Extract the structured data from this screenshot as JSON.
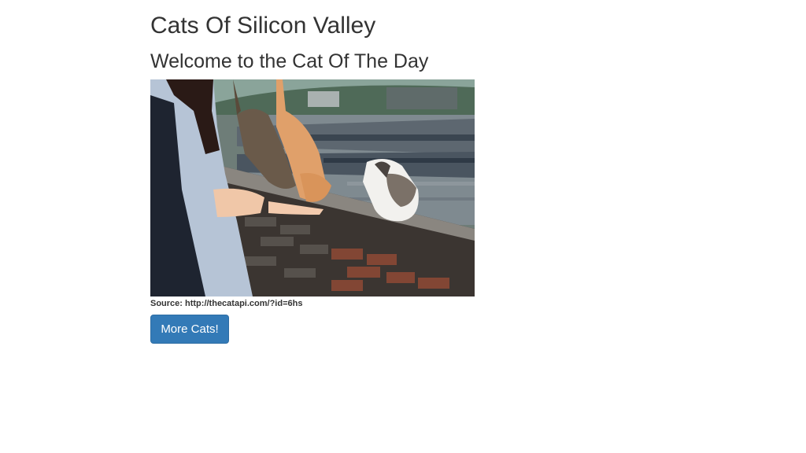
{
  "header": {
    "title": "Cats Of Silicon Valley"
  },
  "main": {
    "heading": "Welcome to the Cat Of The Day",
    "photo": {
      "source_prefix": "Source: ",
      "source_url": "http://thecatapi.com/?id=6hs"
    },
    "more_button_label": "More Cats!"
  },
  "colors": {
    "button_bg": "#337ab7",
    "text": "#333333"
  }
}
